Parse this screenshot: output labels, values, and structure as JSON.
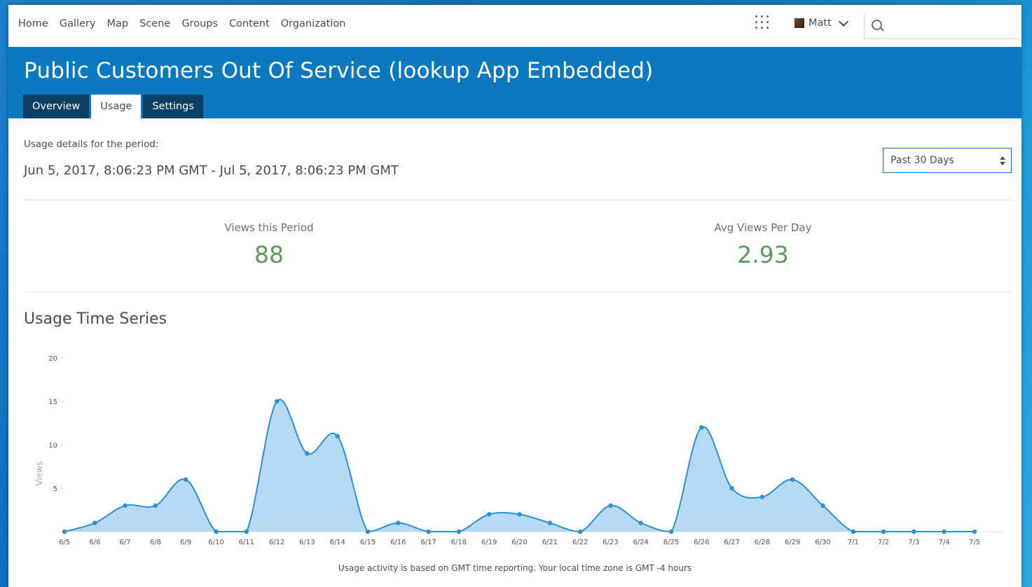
{
  "nav": {
    "items": [
      "Home",
      "Gallery",
      "Map",
      "Scene",
      "Groups",
      "Content",
      "Organization"
    ],
    "user_name": "Matt",
    "search_placeholder": ""
  },
  "banner": {
    "title": "Public Customers Out Of Service (lookup App Embedded)",
    "tabs": [
      {
        "label": "Overview",
        "active": false
      },
      {
        "label": "Usage",
        "active": true
      },
      {
        "label": "Settings",
        "active": false
      }
    ]
  },
  "usage": {
    "period_label": "Usage details for the period:",
    "period_range": "Jun 5, 2017, 8:06:23 PM GMT - Jul 5, 2017, 8:06:23 PM GMT",
    "period_select": "Past 30 Days",
    "views_label": "Views this Period",
    "views_value": "88",
    "avg_label": "Avg Views Per Day",
    "avg_value": "2.93",
    "section_title": "Usage Time Series",
    "footnote": "Usage activity is based on GMT time reporting. Your local time zone is GMT -4 hours"
  },
  "colors": {
    "accent": "#0a79c0",
    "line": "#2d8fd6",
    "fill": "#a9d4f5",
    "stat": "#5a9a5a"
  },
  "chart_data": {
    "type": "area",
    "title": "Usage Time Series",
    "ylabel": "Views",
    "xlabel": "",
    "ylim": [
      0,
      20
    ],
    "yticks": [
      5,
      10,
      15,
      20
    ],
    "categories": [
      "6/5",
      "6/6",
      "6/7",
      "6/8",
      "6/9",
      "6/10",
      "6/11",
      "6/12",
      "6/13",
      "6/14",
      "6/15",
      "6/16",
      "6/17",
      "6/18",
      "6/19",
      "6/20",
      "6/21",
      "6/22",
      "6/23",
      "6/24",
      "6/25",
      "6/26",
      "6/27",
      "6/28",
      "6/29",
      "6/30",
      "7/1",
      "7/2",
      "7/3",
      "7/4",
      "7/5"
    ],
    "values": [
      0,
      1,
      3,
      3,
      6,
      0,
      0,
      15,
      9,
      11,
      0,
      1,
      0,
      0,
      2,
      2,
      1,
      0,
      3,
      1,
      0,
      12,
      5,
      4,
      6,
      3,
      0,
      0,
      0,
      0,
      0
    ]
  }
}
